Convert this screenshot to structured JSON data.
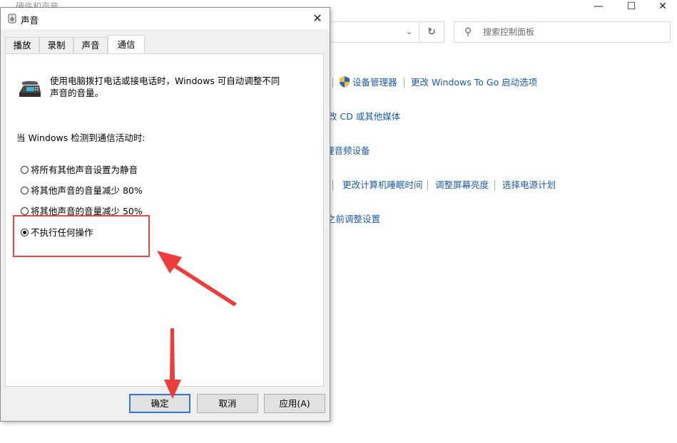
{
  "background": {
    "title": "硬件和声音",
    "search_placeholder": "搜索控制面板",
    "links": {
      "device_manager": "设备管理器",
      "windows_to_go": "更改 Windows To Go 启动选项",
      "cd_media": "改 CD 或其他媒体",
      "audio_devices": "理音频设备",
      "sleep_time": "更改计算机睡眠时间",
      "brightness": "调整屏幕亮度",
      "power_plan": "选择电源计划",
      "adjust_settings": "之前调整设置"
    }
  },
  "dialog": {
    "title": "声音",
    "tabs": [
      "播放",
      "录制",
      "声音",
      "通信"
    ],
    "active_tab": "通信",
    "description": "使用电脑拨打电话或接电话时，Windows 可自动调整不同声音的音量。",
    "when_label": "当 Windows 检测到通信活动时:",
    "options": [
      {
        "label": "将所有其他声音设置为静音",
        "selected": false
      },
      {
        "label": "将其他声音的音量减少 80%",
        "selected": false
      },
      {
        "label": "将其他声音的音量减少 50%",
        "selected": false
      },
      {
        "label": "不执行任何操作",
        "selected": true
      }
    ],
    "buttons": {
      "ok": "确定",
      "cancel": "取消",
      "apply": "应用(A)"
    }
  },
  "colors": {
    "accent": "#3078d4",
    "link": "#1c5aa8",
    "annotation": "#e54848"
  }
}
